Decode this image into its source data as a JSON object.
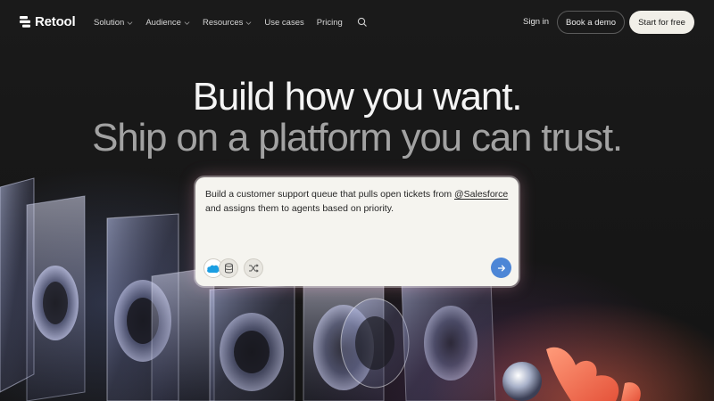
{
  "brand": {
    "name": "Retool"
  },
  "nav": {
    "links": [
      {
        "label": "Solution",
        "dropdown": true
      },
      {
        "label": "Audience",
        "dropdown": true
      },
      {
        "label": "Resources",
        "dropdown": true
      },
      {
        "label": "Use cases",
        "dropdown": false
      },
      {
        "label": "Pricing",
        "dropdown": false
      }
    ],
    "sign_in": "Sign in",
    "book_demo": "Book a demo",
    "start_free": "Start for free"
  },
  "hero": {
    "headline": "Build how you want.",
    "subheadline": "Ship on a platform you can trust."
  },
  "prompt": {
    "text_before": "Build a customer support queue that pulls open tickets from ",
    "mention": "@Salesforce",
    "text_after": " and assigns them to agents based on priority.",
    "chips": [
      "salesforce-icon",
      "database-icon",
      "shuffle-icon"
    ],
    "send_icon": "arrow-right-icon"
  },
  "colors": {
    "background": "#161616",
    "card": "#f5f4ef",
    "send_button": "#4d86d6",
    "start_button": "#f1efe8",
    "salesforce": "#1b9ee2"
  }
}
